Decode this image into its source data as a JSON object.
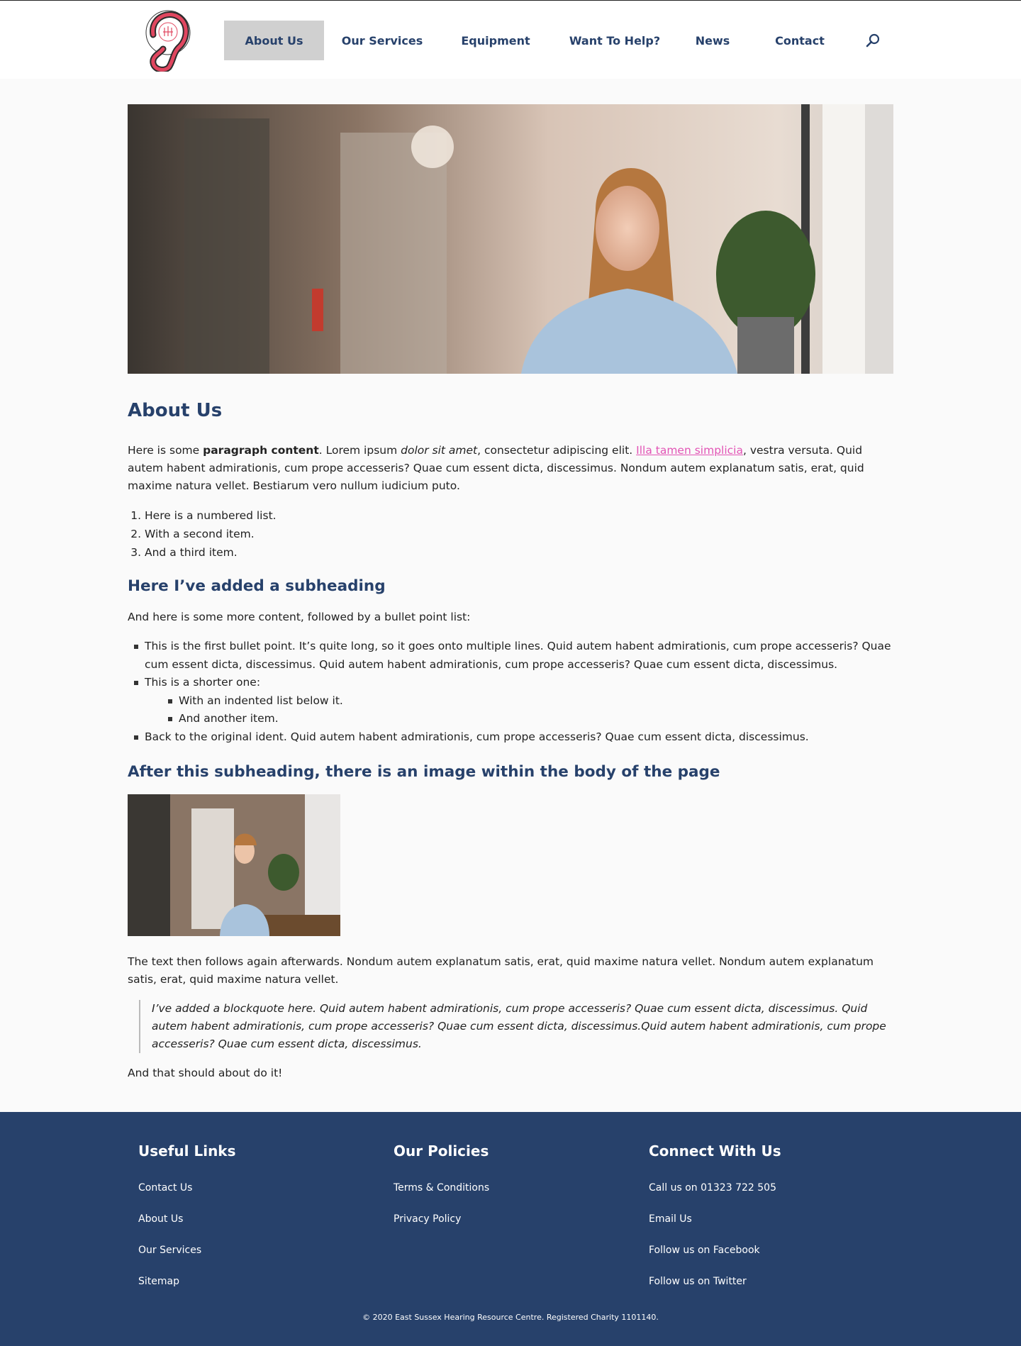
{
  "header": {
    "nav": [
      {
        "label": "About Us",
        "active": true
      },
      {
        "label": "Our Services",
        "active": false
      },
      {
        "label": "Equipment",
        "active": false
      },
      {
        "label": "Want To Help?",
        "active": false
      },
      {
        "label": "News",
        "active": false
      },
      {
        "label": "Contact",
        "active": false
      }
    ],
    "search_icon": "search-icon",
    "logo_icon": "ear-logo"
  },
  "content": {
    "title": "About Us",
    "intro": {
      "t1": "Here is some ",
      "bold": "paragraph content",
      "t2": ". Lorem ipsum ",
      "em": "dolor sit amet",
      "t3": ", consectetur adipiscing elit. ",
      "link": "Illa tamen simplicia",
      "t4": ", vestra versuta. Quid autem habent admirationis, cum prope accesseris? Quae cum essent dicta, discessimus. Nondum autem explanatum satis, erat, quid maxime natura vellet. Bestiarum vero nullum iudicium puto."
    },
    "numbered": [
      "Here is a numbered list.",
      "With a second item.",
      "And a third item."
    ],
    "subheading1": "Here I’ve added a subheading",
    "bullet_intro": "And here is some more content, followed by a bullet point list:",
    "bullets": {
      "b1": "This is the first bullet point. It’s quite long, so it goes onto multiple lines. Quid autem habent admirationis, cum prope accesseris? Quae cum essent dicta, discessimus. Quid autem habent admirationis, cum prope accesseris? Quae cum essent dicta, discessimus.",
      "b2": "This is a shorter one:",
      "b2a": "With an indented list below it.",
      "b2b": "And another item.",
      "b3": "Back to the original ident. Quid autem habent admirationis, cum prope accesseris? Quae cum essent dicta, discessimus."
    },
    "subheading2": "After this subheading, there is an image within the body of the page",
    "after_image": "The text then follows again afterwards. Nondum autem explanatum satis, erat, quid maxime natura vellet. Nondum autem explanatum satis, erat, quid maxime natura vellet.",
    "quote": "I’ve added a blockquote here. Quid autem habent admirationis, cum prope accesseris? Quae cum essent dicta, discessimus. Quid autem habent admirationis, cum prope accesseris? Quae cum essent dicta, discessimus.Quid autem habent admirationis, cum prope accesseris? Quae cum essent dicta, discessimus.",
    "ending": "And that should about do it!"
  },
  "footer": {
    "useful": {
      "title": "Useful Links",
      "links": [
        "Contact Us",
        "About Us",
        "Our Services",
        "Sitemap"
      ]
    },
    "policies": {
      "title": "Our Policies",
      "links": [
        "Terms & Conditions",
        "Privacy Policy"
      ]
    },
    "connect": {
      "title": "Connect With Us",
      "links": [
        "Call us on 01323 722 505",
        "Email Us",
        "Follow us on Facebook",
        "Follow us on Twitter"
      ]
    },
    "copyright": "© 2020 East Sussex Hearing Resource Centre. Registered Charity 1101140."
  },
  "colors": {
    "brand": "#27416b",
    "link": "#e254b5",
    "accent": "#e0465f"
  }
}
